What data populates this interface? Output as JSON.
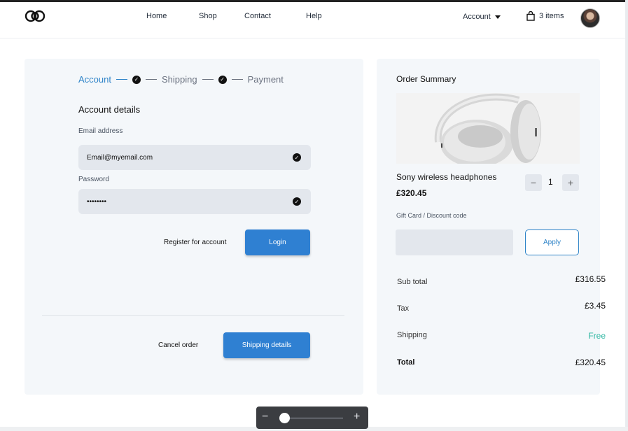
{
  "nav": {
    "home": "Home",
    "shop": "Shop",
    "contact": "Contact",
    "help": "Help"
  },
  "header": {
    "account": "Account",
    "cart": "3 items"
  },
  "steps": {
    "account": "Account",
    "shipping": "Shipping",
    "payment": "Payment"
  },
  "form": {
    "title": "Account details",
    "email_label": "Email address",
    "email_value": "Email@myemail.com",
    "password_label": "Password",
    "password_value": "••••••••",
    "register": "Register for account",
    "login": "Login",
    "cancel": "Cancel order",
    "next": "Shipping details"
  },
  "summary": {
    "title": "Order Summary",
    "product_name": "Sony wireless headphones",
    "product_price": "£320.45",
    "quantity": "1",
    "gift_label": "Gift Card / Discount code",
    "apply": "Apply",
    "subtotal_label": "Sub total",
    "subtotal": "£316.55",
    "tax_label": "Tax",
    "tax": "£3.45",
    "shipping_label": "Shipping",
    "shipping": "Free",
    "total_label": "Total",
    "total": "£320.45"
  },
  "colors": {
    "accent": "#2f80d2",
    "free": "#2bb5a0",
    "panel": "#f4f7fa"
  },
  "zoom": {
    "level": 0.05
  }
}
